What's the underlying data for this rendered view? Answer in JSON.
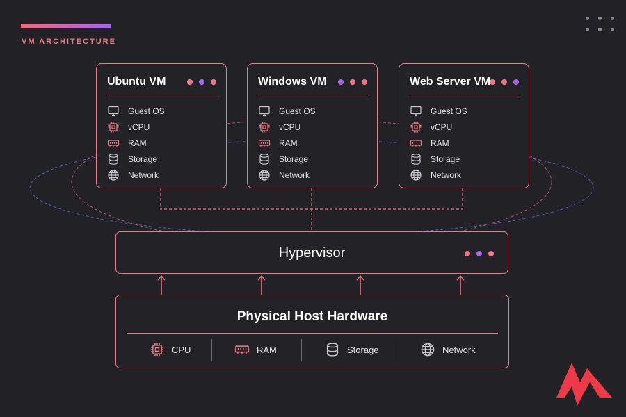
{
  "header": {
    "title": "VM ARCHITECTURE"
  },
  "colors": {
    "accent_pink": "#f07785",
    "accent_purple": "#a865f0",
    "background": "#222226"
  },
  "vms": [
    {
      "name": "Ubuntu VM",
      "dots": [
        "pink",
        "purple",
        "pink"
      ],
      "resources": [
        {
          "icon": "monitor-icon",
          "label": "Guest OS"
        },
        {
          "icon": "cpu-icon",
          "label": "vCPU"
        },
        {
          "icon": "ram-icon",
          "label": "RAM"
        },
        {
          "icon": "database-icon",
          "label": "Storage"
        },
        {
          "icon": "globe-icon",
          "label": "Network"
        }
      ]
    },
    {
      "name": "Windows VM",
      "dots": [
        "purple",
        "pink",
        "pink"
      ],
      "resources": [
        {
          "icon": "monitor-icon",
          "label": "Guest OS"
        },
        {
          "icon": "cpu-icon",
          "label": "vCPU"
        },
        {
          "icon": "ram-icon",
          "label": "RAM"
        },
        {
          "icon": "database-icon",
          "label": "Storage"
        },
        {
          "icon": "globe-icon",
          "label": "Network"
        }
      ]
    },
    {
      "name": "Web Server VM",
      "dots": [
        "pink",
        "pink",
        "purple"
      ],
      "resources": [
        {
          "icon": "monitor-icon",
          "label": "Guest OS"
        },
        {
          "icon": "cpu-icon",
          "label": "vCPU"
        },
        {
          "icon": "ram-icon",
          "label": "RAM"
        },
        {
          "icon": "database-icon",
          "label": "Storage"
        },
        {
          "icon": "globe-icon",
          "label": "Network"
        }
      ]
    }
  ],
  "hypervisor": {
    "label": "Hypervisor",
    "dots": [
      "pink",
      "purple",
      "pink"
    ]
  },
  "hardware": {
    "title": "Physical Host Hardware",
    "items": [
      {
        "icon": "cpu-icon",
        "label": "CPU"
      },
      {
        "icon": "ram-icon",
        "label": "RAM"
      },
      {
        "icon": "database-icon",
        "label": "Storage"
      },
      {
        "icon": "globe-icon",
        "label": "Network"
      }
    ]
  }
}
